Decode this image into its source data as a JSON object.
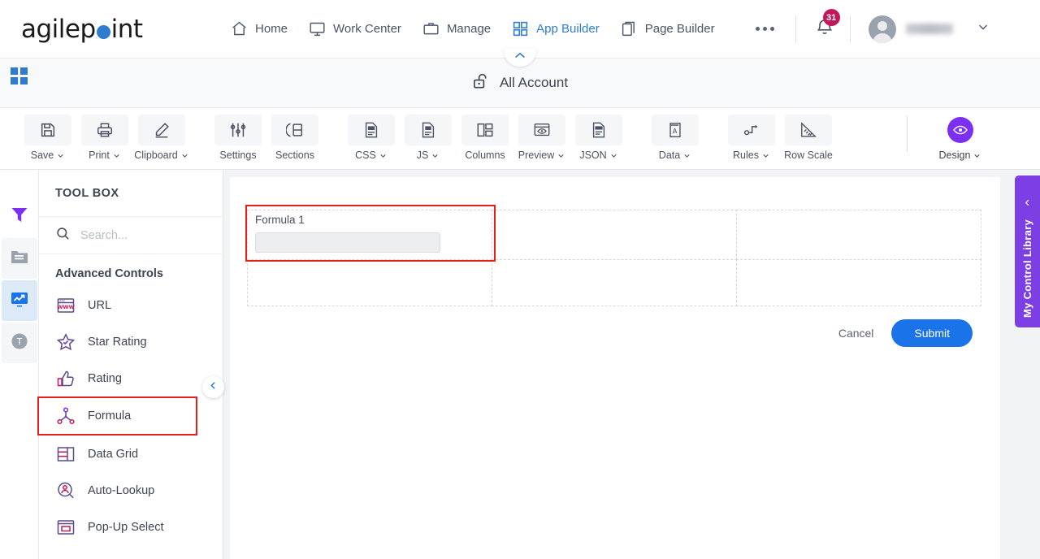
{
  "header": {
    "logo_text_before": "agilep",
    "logo_text_after": "int",
    "nav": [
      {
        "label": "Home",
        "icon": "home-icon",
        "active": false
      },
      {
        "label": "Work Center",
        "icon": "monitor-icon",
        "active": false
      },
      {
        "label": "Manage",
        "icon": "briefcase-icon",
        "active": false
      },
      {
        "label": "App Builder",
        "icon": "grid-icon",
        "active": true
      },
      {
        "label": "Page Builder",
        "icon": "copy-pages-icon",
        "active": false
      }
    ],
    "more_label": "...",
    "notification_count": "31",
    "username": "",
    "accent_blue": "#2e7bd0",
    "badge_color": "#c2185b"
  },
  "subheader": {
    "title": "All Account",
    "icon": "unlock-icon",
    "collapse_icon": "chevron-up-icon"
  },
  "toolbar": {
    "buttons": [
      {
        "label": "Save",
        "icon": "save-floppy-icon",
        "caret": true
      },
      {
        "label": "Print",
        "icon": "printer-icon",
        "caret": true
      },
      {
        "label": "Clipboard",
        "icon": "pencil-edit-icon",
        "caret": true
      },
      {
        "label": "Settings",
        "icon": "sliders-icon",
        "caret": false
      },
      {
        "label": "Sections",
        "icon": "split-panel-icon",
        "caret": false
      },
      {
        "label": "CSS",
        "icon": "css-file-icon",
        "caret": true
      },
      {
        "label": "JS",
        "icon": "js-file-icon",
        "caret": true
      },
      {
        "label": "Columns",
        "icon": "columns-layout-icon",
        "caret": false
      },
      {
        "label": "Preview",
        "icon": "eye-window-icon",
        "caret": true
      },
      {
        "label": "JSON",
        "icon": "json-file-icon",
        "caret": true
      },
      {
        "label": "Data",
        "icon": "book-a-icon",
        "caret": true
      },
      {
        "label": "Rules",
        "icon": "rules-flow-icon",
        "caret": true
      },
      {
        "label": "Row Scale",
        "icon": "ruler-icon",
        "caret": false
      }
    ],
    "design": {
      "label": "Design",
      "icon": "eye-icon",
      "caret": true,
      "color": "#7b2ff2"
    }
  },
  "rail": {
    "items": [
      {
        "name": "filter-funnel-icon",
        "state": "normal"
      },
      {
        "name": "folder-list-icon",
        "state": "gray"
      },
      {
        "name": "chart-monitor-icon",
        "state": "active"
      },
      {
        "name": "text-t-icon",
        "state": "gray"
      }
    ]
  },
  "toolbox": {
    "title": "TOOL BOX",
    "search_placeholder": "Search...",
    "search_value": "",
    "search_icon": "search-icon",
    "section_label": "Advanced Controls",
    "items": [
      {
        "label": "URL",
        "icon": "url-www-icon",
        "selected": false
      },
      {
        "label": "Star Rating",
        "icon": "star-icon",
        "selected": false
      },
      {
        "label": "Rating",
        "icon": "thumbs-up-icon",
        "selected": false
      },
      {
        "label": "Formula",
        "icon": "formula-node-icon",
        "selected": true
      },
      {
        "label": "Data Grid",
        "icon": "data-grid-icon",
        "selected": false
      },
      {
        "label": "Auto-Lookup",
        "icon": "auto-lookup-icon",
        "selected": false
      },
      {
        "label": "Pop-Up Select",
        "icon": "popup-select-icon",
        "selected": false
      }
    ],
    "collapse_icon": "chevron-left-icon",
    "highlight_color": "#e32119"
  },
  "canvas": {
    "field_label": "Formula 1",
    "field_value": "",
    "cancel_label": "Cancel",
    "submit_label": "Submit",
    "submit_color": "#1a73e8"
  },
  "library_panel": {
    "title": "My Control Library",
    "chevron": "chevron-left-icon",
    "color": "#7b3fe4"
  }
}
